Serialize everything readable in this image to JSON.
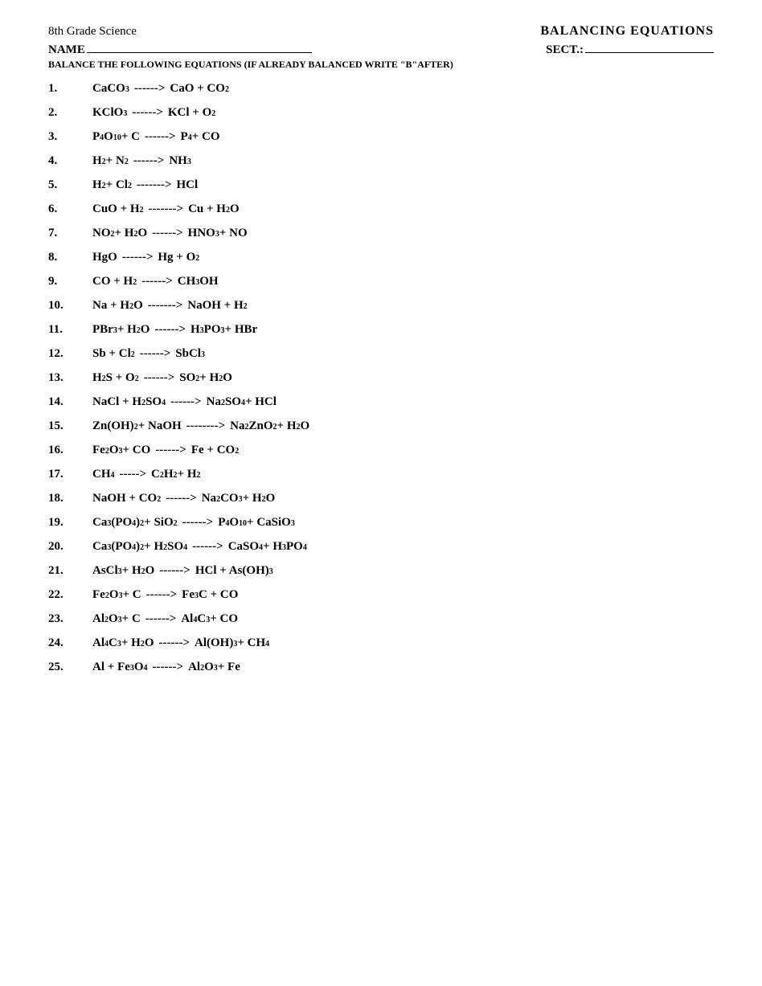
{
  "header": {
    "subject": "8th Grade Science",
    "title": "BALANCING EQUATIONS",
    "name_label": "NAME",
    "sect_label": "SECT.:",
    "instruction": "BALANCE THE FOLLOWING EQUATIONS (IF ALREADY BALANCED WRITE \"B\"AFTER)"
  },
  "equations": [
    {
      "num": "1.",
      "html": "CaCO<sub>3</sub> <span class='arrow'>------&gt;</span> CaO + CO<sub>2</sub>"
    },
    {
      "num": "2.",
      "html": "KClO<sub>3</sub> <span class='arrow'>------&gt;</span> KCl + O<sub>2</sub>"
    },
    {
      "num": "3.",
      "html": "P<sub>4</sub>O<sub>10</sub> + C <span class='arrow'>------&gt;</span> P<sub>4</sub> + CO"
    },
    {
      "num": "4.",
      "html": "H<sub>2</sub> + N<sub>2</sub> <span class='arrow'>------&gt;</span> NH<sub>3</sub>"
    },
    {
      "num": "5.",
      "html": "H<sub>2</sub> + Cl<sub>2</sub> <span class='arrow'>-------&gt;</span> HCl"
    },
    {
      "num": "6.",
      "html": "CuO + H<sub>2</sub> <span class='arrow'>-------&gt;</span> Cu + H<sub>2</sub>O"
    },
    {
      "num": "7.",
      "html": "NO<sub>2</sub> + H<sub>2</sub>O <span class='arrow'>------&gt;</span> HNO<sub>3</sub> + NO"
    },
    {
      "num": "8.",
      "html": "HgO <span class='arrow'>------&gt;</span> Hg + O<sub>2</sub>"
    },
    {
      "num": "9.",
      "html": "CO + H<sub>2</sub> <span class='arrow'>------&gt;</span> CH<sub>3</sub>OH"
    },
    {
      "num": "10.",
      "html": "Na + H<sub>2</sub>O <span class='arrow'>-------&gt;</span> NaOH + H<sub>2</sub>"
    },
    {
      "num": "11.",
      "html": "PBr<sub>3</sub> + H<sub>2</sub>O <span class='arrow'>------&gt;</span> H<sub>3</sub>PO<sub>3</sub> + HBr"
    },
    {
      "num": "12.",
      "html": "Sb + Cl<sub>2</sub> <span class='arrow'>------&gt;</span> SbCl<sub>3</sub>"
    },
    {
      "num": "13.",
      "html": "H<sub>2</sub>S + O<sub>2</sub> <span class='arrow'>------&gt;</span> SO<sub>2</sub> + H<sub>2</sub>O"
    },
    {
      "num": "14.",
      "html": "NaCl + H<sub>2</sub>SO<sub>4</sub> <span class='arrow'>------&gt;</span> Na<sub>2</sub>SO<sub>4</sub> + HCl"
    },
    {
      "num": "15.",
      "html": "Zn(OH)<sub>2</sub> + NaOH <span class='arrow'>--------&gt;</span> Na<sub>2</sub>ZnO<sub>2</sub> + H<sub>2</sub>O"
    },
    {
      "num": "16.",
      "html": "Fe<sub>2</sub>O<sub>3</sub> + CO <span class='arrow'>------&gt;</span> Fe + CO<sub>2</sub>"
    },
    {
      "num": "17.",
      "html": "CH<sub>4</sub> <span class='arrow'>-----&gt;</span> C<sub>2</sub>H<sub>2</sub> + H<sub>2</sub>"
    },
    {
      "num": "18.",
      "html": "NaOH + CO<sub>2</sub> <span class='arrow'>------&gt;</span> Na<sub>2</sub>CO<sub>3</sub> + H<sub>2</sub>O"
    },
    {
      "num": "19.",
      "html": "Ca<sub>3</sub>(PO<sub>4</sub>)<sub>2</sub> + SiO<sub>2</sub> <span class='arrow'>------&gt;</span> P<sub>4</sub>O<sub>10</sub> + CaSiO<sub>3</sub>"
    },
    {
      "num": "20.",
      "html": "Ca<sub>3</sub>(PO<sub>4</sub>)<sub>2</sub> + H<sub>2</sub>SO<sub>4</sub> <span class='arrow'>------&gt;</span> CaSO<sub>4</sub> + H<sub>3</sub>PO<sub>4</sub>"
    },
    {
      "num": "21.",
      "html": "AsCl<sub>3</sub> + H<sub>2</sub>O <span class='arrow'>------&gt;</span> HCl + As(OH)<sub>3</sub>"
    },
    {
      "num": "22.",
      "html": "Fe<sub>2</sub>O<sub>3</sub> + C <span class='arrow'>------&gt;</span> Fe<sub>3</sub>C + CO"
    },
    {
      "num": "23.",
      "html": "Al<sub>2</sub>O<sub>3</sub> + C <span class='arrow'>------&gt;</span> Al<sub>4</sub>C<sub>3</sub> + CO"
    },
    {
      "num": "24.",
      "html": "Al<sub>4</sub>C<sub>3</sub> + H<sub>2</sub>O <span class='arrow'>------&gt;</span> Al(OH)<sub>3</sub> + CH<sub>4</sub>"
    },
    {
      "num": "25.",
      "html": "Al + Fe<sub>3</sub>O<sub>4</sub> <span class='arrow'>------&gt;</span> Al<sub>2</sub>O<sub>3</sub> + Fe"
    }
  ]
}
